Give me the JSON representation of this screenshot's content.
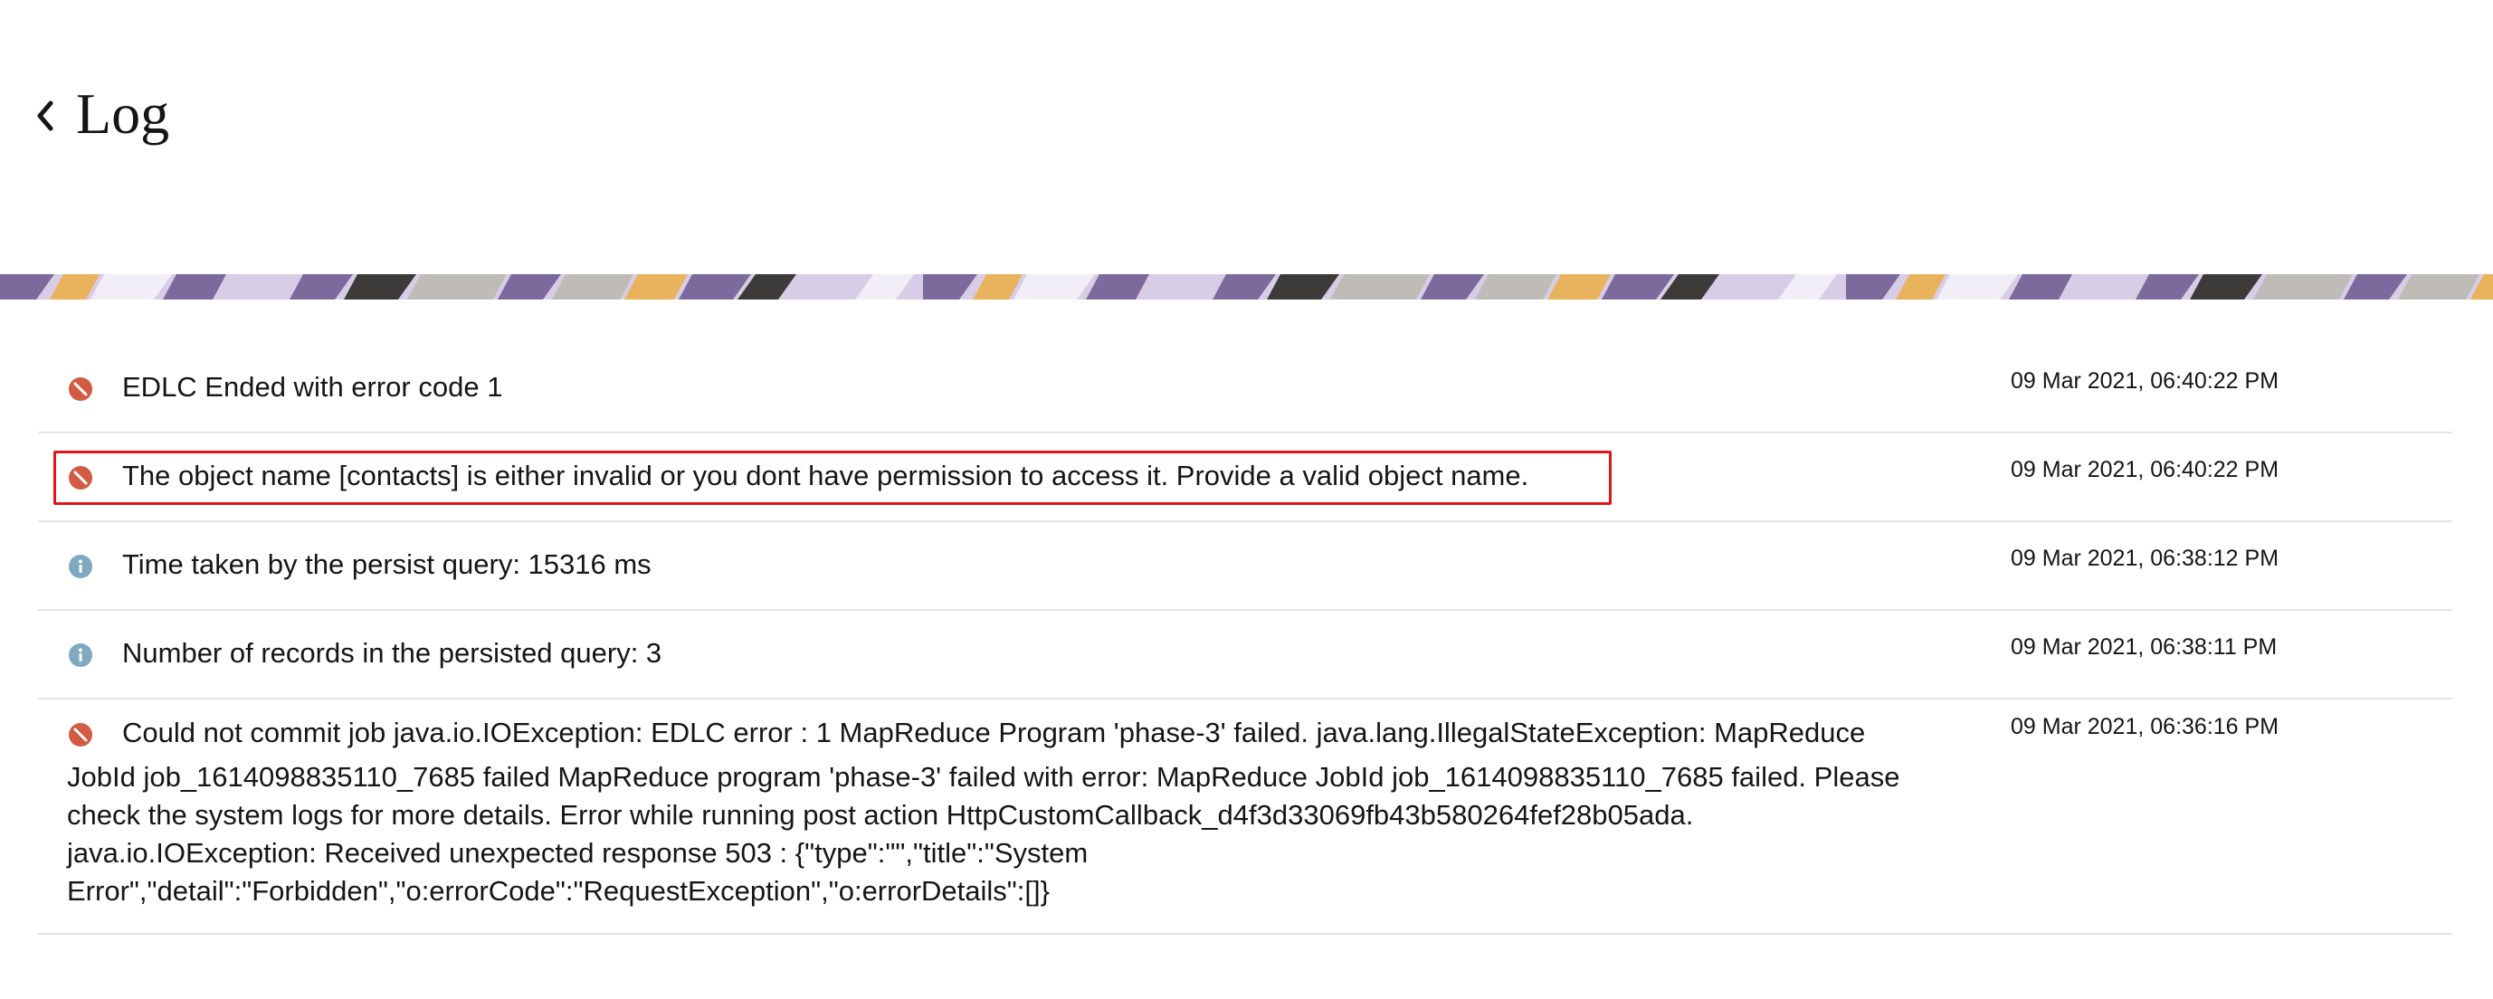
{
  "header": {
    "title": "Log",
    "back_icon": "chevron-left-icon"
  },
  "banner": {
    "colors": [
      "#7c6a9c",
      "#d8cde6",
      "#e9b25c",
      "#3d3b3a",
      "#bfbcb8",
      "#f2eef7"
    ]
  },
  "status_colors": {
    "error": "#d25b43",
    "info": "#7fa8c1"
  },
  "logs": [
    {
      "type": "error",
      "icon": "error-icon",
      "message": "EDLC Ended with error code 1",
      "timestamp": "09 Mar 2021, 06:40:22 PM"
    },
    {
      "type": "error",
      "icon": "error-icon",
      "highlighted": true,
      "message": "The object name [contacts] is either invalid or you dont have permission to access it. Provide a valid object name.",
      "timestamp": "09 Mar 2021, 06:40:22 PM"
    },
    {
      "type": "info",
      "icon": "info-icon",
      "message": "Time taken by the persist query: 15316 ms",
      "timestamp": "09 Mar 2021, 06:38:12 PM"
    },
    {
      "type": "info",
      "icon": "info-icon",
      "message": "Number of records in the persisted query: 3",
      "timestamp": "09 Mar 2021, 06:38:11 PM"
    },
    {
      "type": "error",
      "icon": "error-icon",
      "message_first_line": "Could not commit job java.io.IOException: EDLC error : 1 MapReduce Program 'phase-3' failed. java.lang.IllegalStateException: MapReduce",
      "message_rest": "JobId job_1614098835110_7685 failed MapReduce program 'phase-3' failed with error: MapReduce JobId job_1614098835110_7685 failed. Please\ncheck the system logs for more details. Error while running post action HttpCustomCallback_d4f3d33069fb43b580264fef28b05ada.\njava.io.IOException: Received unexpected response 503 : {\"type\":\"\",\"title\":\"System\nError\",\"detail\":\"Forbidden\",\"o:errorCode\":\"RequestException\",\"o:errorDetails\":[]}",
      "timestamp": "09 Mar 2021, 06:36:16 PM"
    }
  ]
}
